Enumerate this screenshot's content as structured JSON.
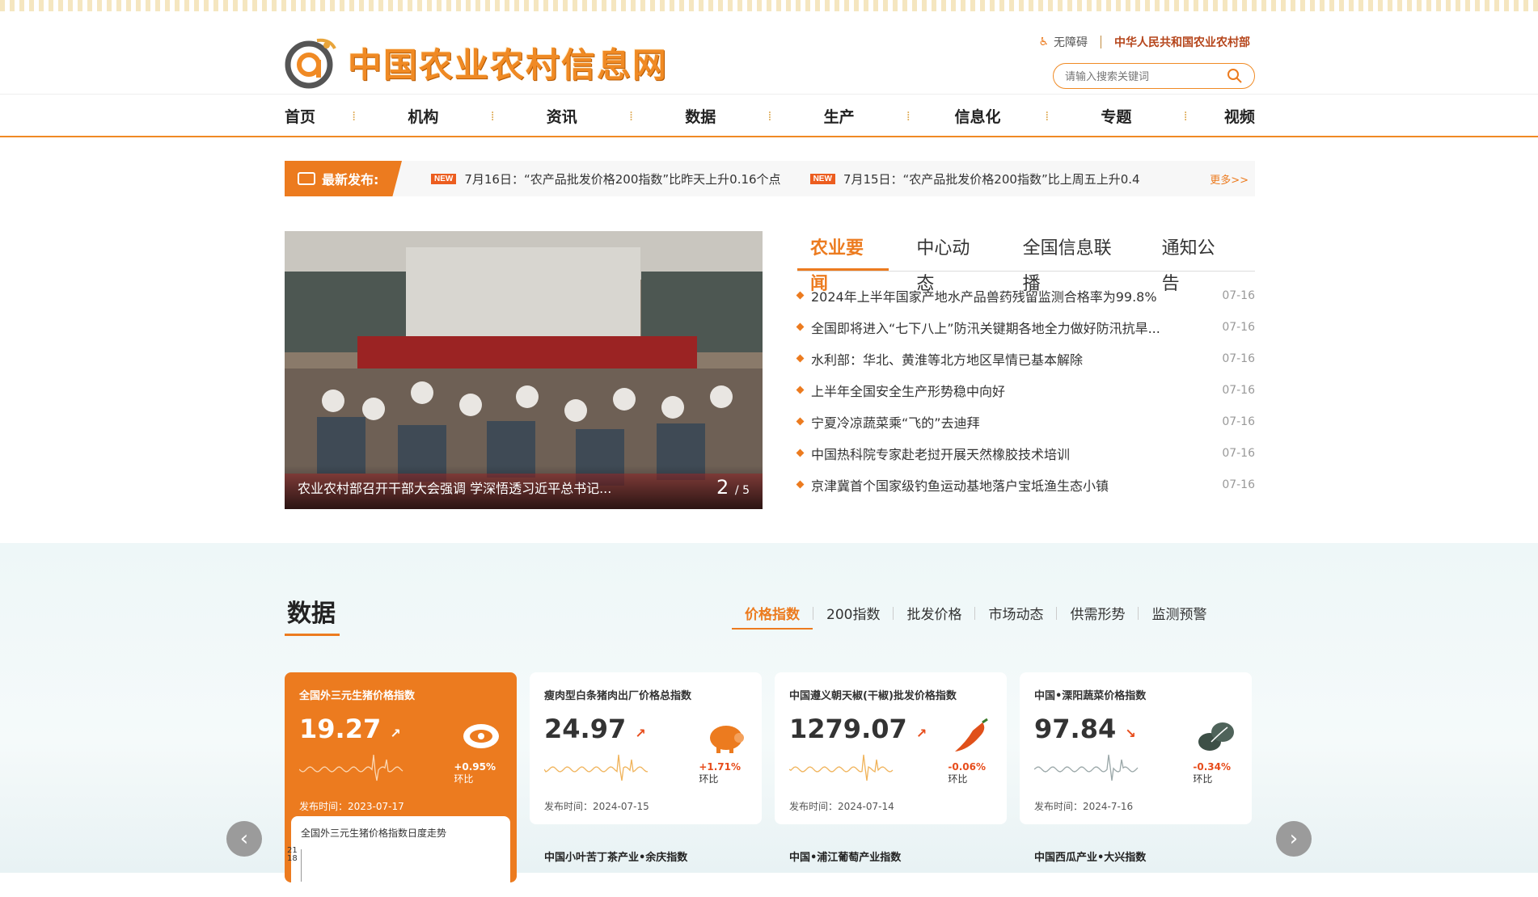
{
  "header": {
    "logo_text": "中国农业农村信息网",
    "accessibility_label": "无障碍",
    "ministry_label": "中华人民共和国农业农村部",
    "search_placeholder": "请输入搜索关键词"
  },
  "nav": {
    "items": [
      "首页",
      "机构",
      "资讯",
      "数据",
      "生产",
      "信息化",
      "专题",
      "视频"
    ]
  },
  "ticker": {
    "label": "最新发布:",
    "items": [
      {
        "badge": "NEW",
        "text": "7月16日：“农产品批发价格200指数”比昨天上升0.16个点"
      },
      {
        "badge": "NEW",
        "text": "7月15日：“农产品批发价格200指数”比上周五上升0.4"
      }
    ],
    "more": "更多>>"
  },
  "slider": {
    "caption": "农业农村部召开干部大会强调 学深悟透习近平总书记...",
    "page_current": "2",
    "page_total": "/ 5"
  },
  "news": {
    "tabs": [
      "农业要闻",
      "中心动态",
      "全国信息联播",
      "通知公告"
    ],
    "active_tab": 0,
    "items": [
      {
        "title": "2024年上半年国家产地水产品兽药残留监测合格率为99.8%",
        "date": "07-16"
      },
      {
        "title": "全国即将进入“七下八上”防汛关键期各地全力做好防汛抗旱...",
        "date": "07-16"
      },
      {
        "title": "水利部：华北、黄淮等北方地区旱情已基本解除",
        "date": "07-16"
      },
      {
        "title": "上半年全国安全生产形势稳中向好",
        "date": "07-16"
      },
      {
        "title": "宁夏冷凉蔬菜乘“飞的”去迪拜",
        "date": "07-16"
      },
      {
        "title": "中国热科院专家赴老挝开展天然橡胶技术培训",
        "date": "07-16"
      },
      {
        "title": "京津冀首个国家级钓鱼运动基地落户宝坻渔生态小镇",
        "date": "07-16"
      }
    ]
  },
  "data_section": {
    "title": "数据",
    "tabs": [
      "价格指数",
      "200指数",
      "批发价格",
      "市场动态",
      "供需形势",
      "监测预警"
    ],
    "active_tab": 0,
    "cards": [
      {
        "name": "全国外三元生猪价格指数",
        "value": "19.27",
        "change": "+0.95%",
        "change_label": "环比",
        "date": "发布时间：2023-07-17",
        "icon": "ham-icon",
        "trend": "up"
      },
      {
        "name": "瘦肉型白条猪肉出厂价格总指数",
        "value": "24.97",
        "change": "+1.71%",
        "change_label": "环比",
        "date": "发布时间：2024-07-15",
        "icon": "pig-icon",
        "trend": "up"
      },
      {
        "name": "中国遵义朝天椒(干椒)批发价格指数",
        "value": "1279.07",
        "change": "-0.06%",
        "change_label": "环比",
        "date": "发布时间：2024-07-14",
        "icon": "chili-icon",
        "trend": "up"
      },
      {
        "name": "中国•溧阳蔬菜价格指数",
        "value": "97.84",
        "change": "-0.34%",
        "change_label": "环比",
        "date": "发布时间：2024-7-16",
        "icon": "vegetable-icon",
        "trend": "down"
      }
    ],
    "sub_chart_title": "全国外三元生猪价格指数日度走势",
    "sub_chart_ticks": [
      "21",
      "18"
    ],
    "row2": [
      "中国小叶苦丁茶产业•余庆指数",
      "中国•浦江葡萄产业指数",
      "中国西瓜产业•大兴指数"
    ]
  }
}
